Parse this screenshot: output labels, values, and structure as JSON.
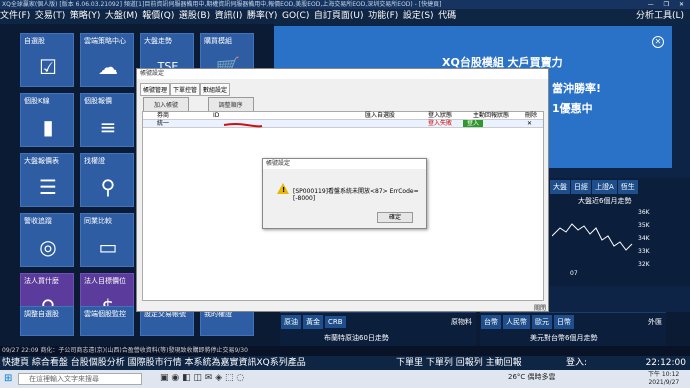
{
  "window": {
    "title": "XQ全球贏家(個人版) [版本 6.06.03.21092]",
    "title_rest": "頻道[1]目前資訊伺服器備用中,期權資訊伺服器備用中,報價EOD,美股EOD,上海交易所EOD,深圳交易所EOD) - [快捷頁]",
    "controls": "— ❐ ✕"
  },
  "menu": {
    "items": [
      "文件(F)",
      "交易(T)",
      "策略(Y)",
      "大盤(M)",
      "報價(Q)",
      "選股(B)",
      "資訊(I)",
      "勝率(Y)",
      "GO(C)",
      "自訂頁面(U)",
      "功能(F)",
      "設定(S)",
      "代碼"
    ],
    "right": "分析工具(L)"
  },
  "tiles": [
    {
      "label": "自選股",
      "icon": "☑"
    },
    {
      "label": "雲端策略中心",
      "icon": "☁"
    },
    {
      "label": "大盤走勢",
      "icon": "TSE"
    },
    {
      "label": "購買模組",
      "icon": "🛒"
    },
    {
      "label": "個股K線",
      "icon": "▮"
    },
    {
      "label": "個股報價",
      "icon": "≡"
    },
    {
      "label": "大盤報價表",
      "icon": "☰"
    },
    {
      "label": "找權證",
      "icon": "⚲"
    },
    {
      "label": "警收追蹤",
      "icon": "◎"
    },
    {
      "label": "同業比較",
      "icon": "▭"
    },
    {
      "label": "法人買什麼",
      "icon": "⚲"
    },
    {
      "label": "法人目標價位",
      "icon": "$"
    },
    {
      "label": "調整自選股",
      "icon": ""
    },
    {
      "label": "雲端個股監控",
      "icon": ""
    },
    {
      "label": "設定交易帳號",
      "icon": ""
    },
    {
      "label": "我的權證",
      "icon": ""
    }
  ],
  "banner": {
    "headline": "XQ台股模組 大戶買賣力",
    "line2": "當沖勝率!",
    "line3": "1優惠中"
  },
  "market": {
    "tabs": [
      "大盤",
      "日經",
      "上證A",
      "恆生"
    ],
    "chart_title": "大盤近6個月走勢",
    "y_ticks": [
      "36K",
      "35K",
      "34K",
      "33K",
      "32K"
    ],
    "x_tick": "07"
  },
  "bottom_left": {
    "tabs": [
      "原油",
      "黃金",
      "CRB"
    ],
    "right_label": "原物料",
    "caption": "布蘭特原油60日走勢"
  },
  "bottom_right": {
    "tabs": [
      "台幣",
      "人民幣",
      "歐元",
      "日幣"
    ],
    "right_label": "外匯",
    "caption": "美元對台幣6個月走勢"
  },
  "dialog": {
    "title": "帳號設定",
    "tabs": [
      "帳號管理",
      "下單控管",
      "數組設定"
    ],
    "add_button": "加入帳號",
    "delete_button": "調整順序",
    "columns": [
      "券商",
      "ID",
      "匯入自選股",
      "登入狀態",
      "主動回報狀態",
      "刪除"
    ],
    "row": {
      "broker": "統一",
      "status": "登入失敗",
      "login": "登入",
      "delete": "✕"
    },
    "close_button": "關閉"
  },
  "message": {
    "title": "帳號設定",
    "text": "[SP000119]看盤系統未開放<87> ErrCode=[-8000]",
    "ok": "確定"
  },
  "ticker": "09/27 22:09  商化：子公司商志遠(京)(山西)合盈營收資料(等)發現致收購即將停止交易9/30",
  "statusbar": {
    "left": "快捷頁  綜合看盤  台股個股分析  國際股市行情  本系統為嘉實資訊XQ系列產品",
    "right": "下單里  下單列  回報列  主動回報",
    "user": "登入:",
    "time": "22:12:00"
  },
  "taskbar": {
    "search_placeholder": "在這裡輸入文字來搜尋",
    "weather": "26°C  偶時多雲",
    "clock_time": "下午 10:12",
    "clock_date": "2021/9/27"
  }
}
